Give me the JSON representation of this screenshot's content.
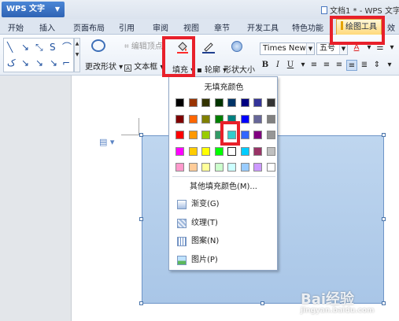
{
  "app": {
    "name": "WPS 文字",
    "document_title": "文档1 * - WPS 文字"
  },
  "tabs": [
    {
      "label": "开始"
    },
    {
      "label": "插入"
    },
    {
      "label": "页面布局"
    },
    {
      "label": "引用"
    },
    {
      "label": "审阅"
    },
    {
      "label": "视图"
    },
    {
      "label": "章节"
    },
    {
      "label": "开发工具"
    },
    {
      "label": "特色功能"
    },
    {
      "label": "绘图工具",
      "active": true
    },
    {
      "label": "效"
    }
  ],
  "ribbon": {
    "change_shape": "更改形状",
    "text_box": "文本框",
    "edit_points": "编辑顶点",
    "fill": "填充",
    "outline": "轮廓",
    "shape_size": "形状大小",
    "font_name": "Times New R",
    "font_size": "五号",
    "font_color": "A",
    "bold": "B",
    "italic": "I",
    "underline": "U"
  },
  "fill_menu": {
    "no_fill": "无填充颜色",
    "more_colors": "其他填充颜色(M)...",
    "items": [
      {
        "label": "渐变(G)",
        "icon": "gradient-icon"
      },
      {
        "label": "纹理(T)",
        "icon": "texture-icon"
      },
      {
        "label": "图案(N)",
        "icon": "pattern-icon"
      },
      {
        "label": "图片(P)",
        "icon": "picture-icon"
      }
    ],
    "palette": [
      [
        "#000000",
        "#993300",
        "#333300",
        "#003300",
        "#003366",
        "#000080",
        "#333399",
        "#333333"
      ],
      [
        "#800000",
        "#FF6600",
        "#808000",
        "#008000",
        "#008080",
        "#0000FF",
        "#666699",
        "#808080"
      ],
      [
        "#FF0000",
        "#FF9900",
        "#99CC00",
        "#339966",
        "#33CCCC",
        "#3366FF",
        "#800080",
        "#969696"
      ],
      [
        "#FF00FF",
        "#FFCC00",
        "#FFFF00",
        "#00FF00",
        "#00FFFF",
        "#00CCFF",
        "#993366",
        "#C0C0C0"
      ],
      [
        "#FF99CC",
        "#FFCC99",
        "#FFFF99",
        "#CCFFCC",
        "#CCFFFF",
        "#99CCFF",
        "#CC99FF",
        "#FFFFFF"
      ]
    ],
    "selected_color": "#FFFFFF"
  },
  "colors": {
    "highlight": "#e8202a",
    "active_tab": "#ffd97a",
    "shape_fill": "#b7d0ec"
  },
  "watermark": {
    "text": "Bai经验",
    "subtext": "jingyan.baidu.com"
  }
}
